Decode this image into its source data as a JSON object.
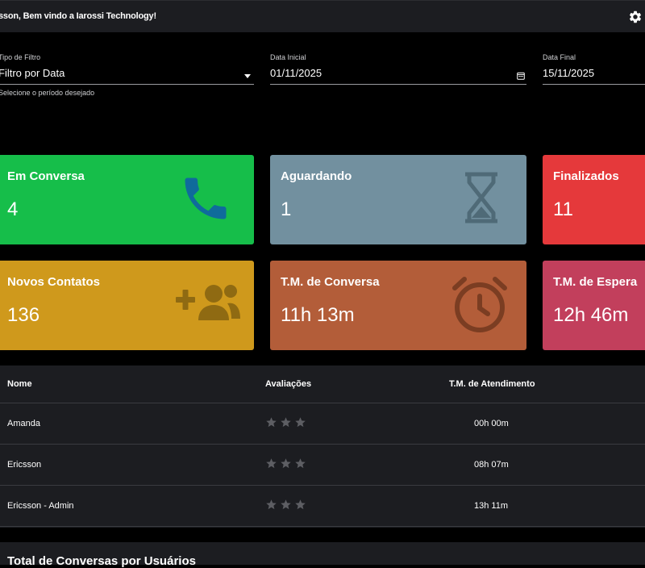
{
  "header": {
    "greeting": "sson, Bem vindo a Iarossi Technology!"
  },
  "filters": {
    "type": {
      "label": "Tipo de Filtro",
      "value": "Filtro por Data",
      "help": "Selecione o período desejado"
    },
    "start": {
      "label": "Data Inicial",
      "value": "01/11/2025"
    },
    "end": {
      "label": "Data Final",
      "value": "15/11/2025"
    }
  },
  "cards": [
    {
      "title": "Em Conversa",
      "value": "4",
      "color": "#16be4a",
      "icon": "phone-icon"
    },
    {
      "title": "Aguardando",
      "value": "1",
      "color": "#72909f",
      "icon": "hourglass-icon"
    },
    {
      "title": "Finalizados",
      "value": "11",
      "color": "#e5393b",
      "icon": "check-icon"
    },
    {
      "title": "Novos Contatos",
      "value": "136",
      "color": "#cf991c",
      "icon": "add-group-icon"
    },
    {
      "title": "T.M. de Conversa",
      "value": "11h 13m",
      "color": "#b35d39",
      "icon": "alarm-clock-icon"
    },
    {
      "title": "T.M. de Espera",
      "value": "12h 46m",
      "color": "#c23f5c",
      "icon": "clock-icon"
    }
  ],
  "table": {
    "headers": [
      "Nome",
      "Avaliações",
      "T.M. de Atendimento"
    ],
    "rows": [
      {
        "name": "Amanda",
        "rating": 0,
        "time": "00h 00m"
      },
      {
        "name": "Ericsson",
        "rating": 0,
        "time": "08h 07m"
      },
      {
        "name": "Ericsson - Admin",
        "rating": 0,
        "time": "13h 11m"
      }
    ]
  },
  "section": {
    "title": "Total de Conversas por Usuários"
  }
}
